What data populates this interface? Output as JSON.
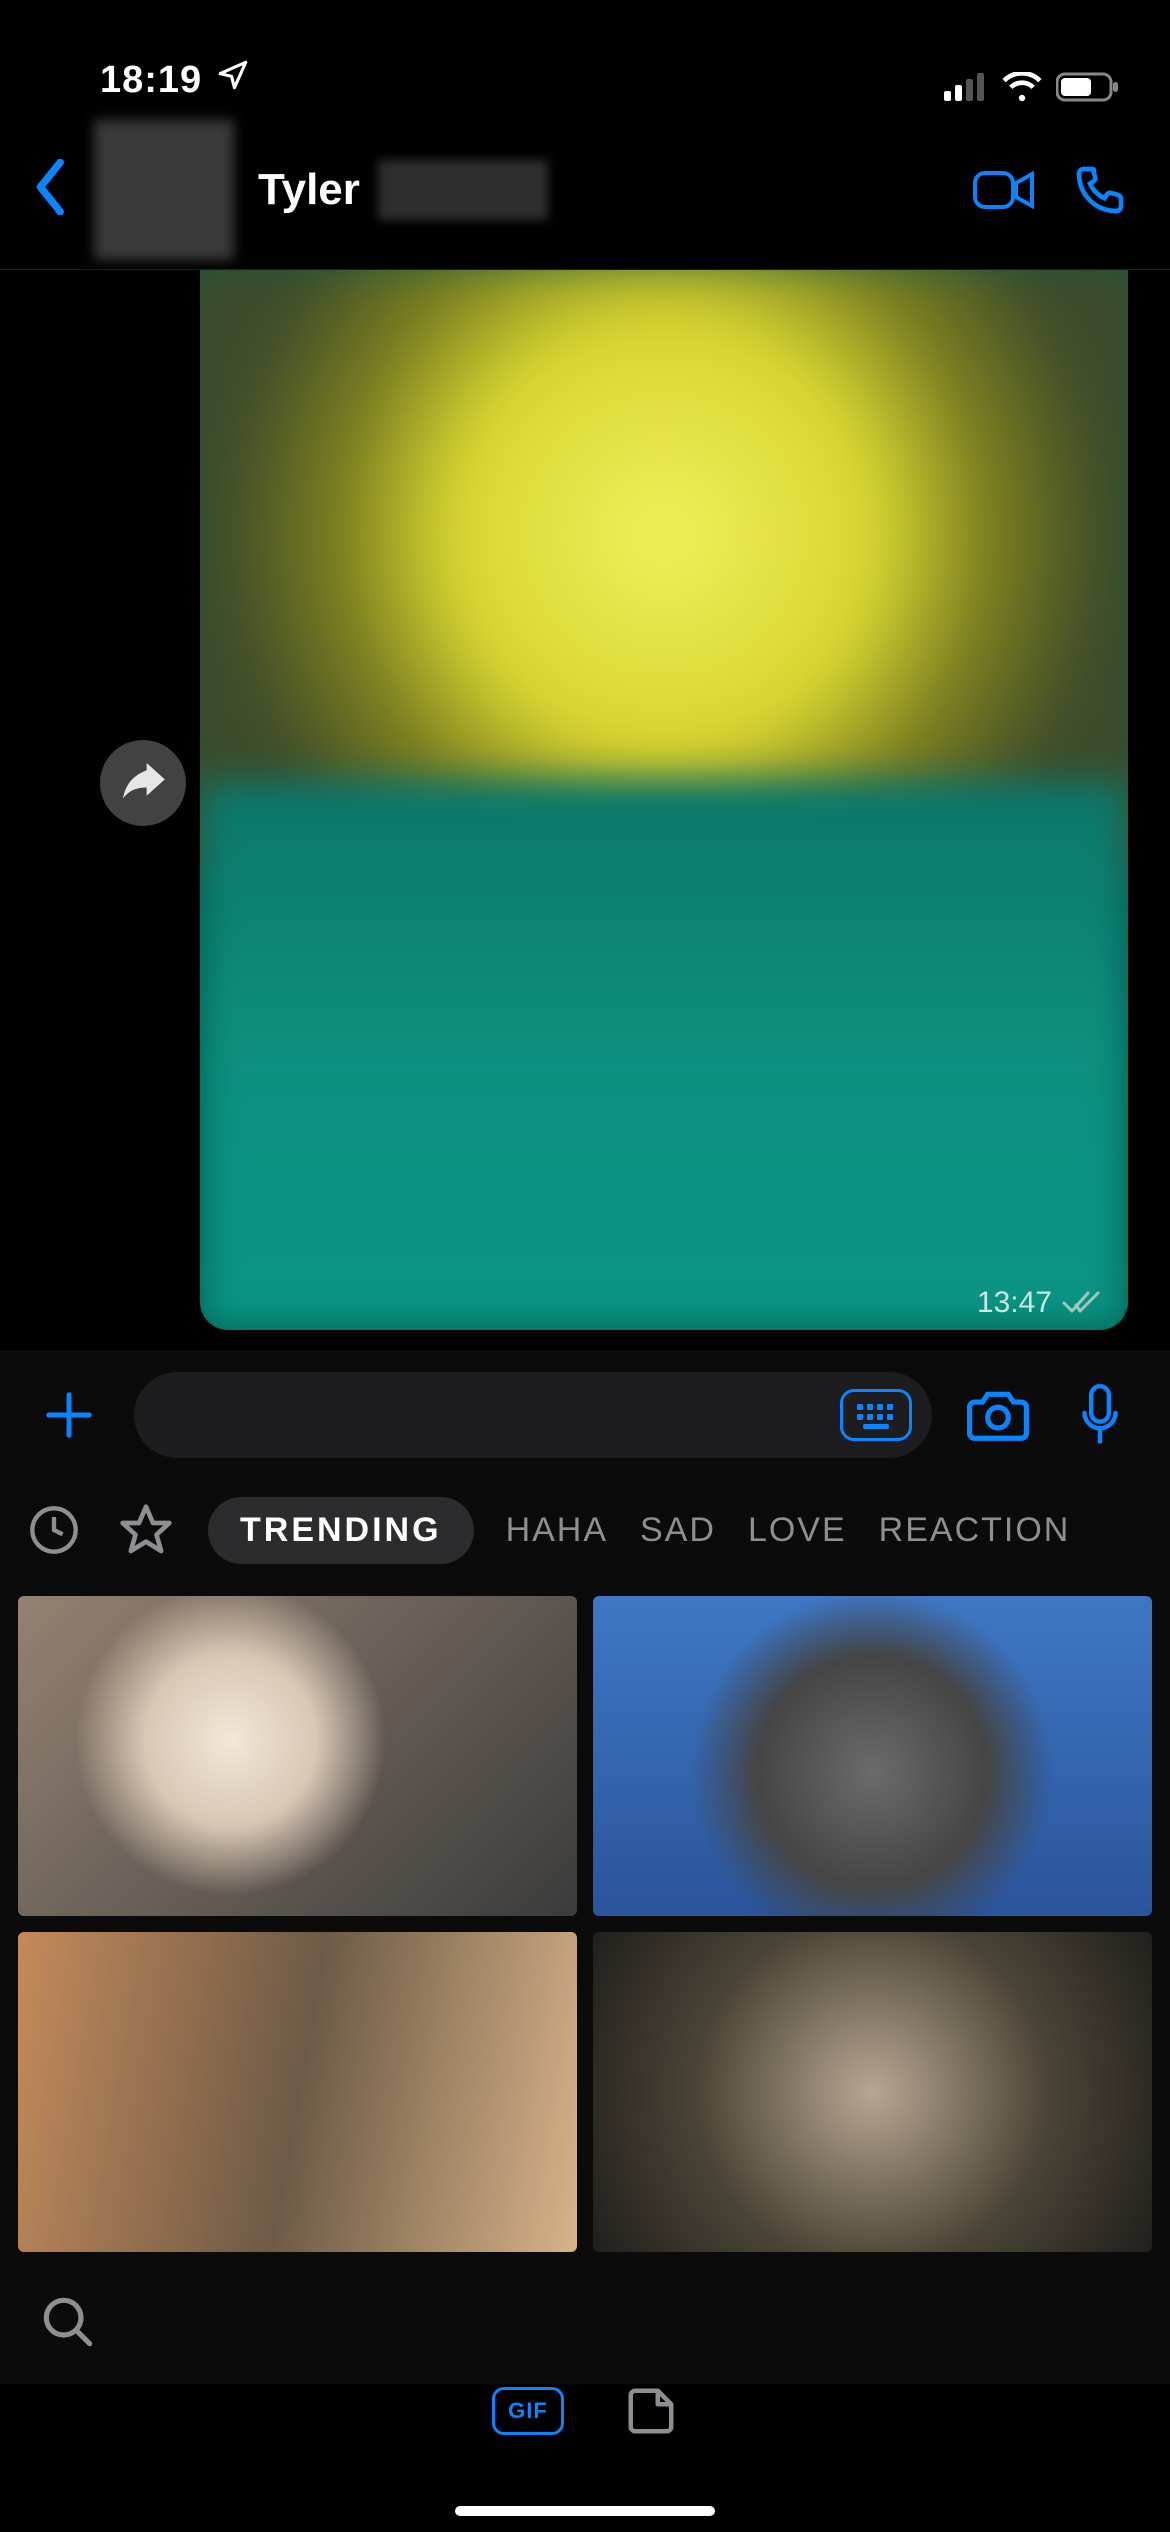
{
  "status": {
    "time": "18:19"
  },
  "header": {
    "contact_name": "Tyler"
  },
  "message": {
    "time": "13:47"
  },
  "gif_categories": {
    "active": "TRENDING",
    "items": [
      "HAHA",
      "SAD",
      "LOVE",
      "REACTION"
    ]
  },
  "picker": {
    "gif_label": "GIF"
  },
  "colors": {
    "accent": "#0a84ff",
    "sent_bubble": "#005c4b"
  }
}
